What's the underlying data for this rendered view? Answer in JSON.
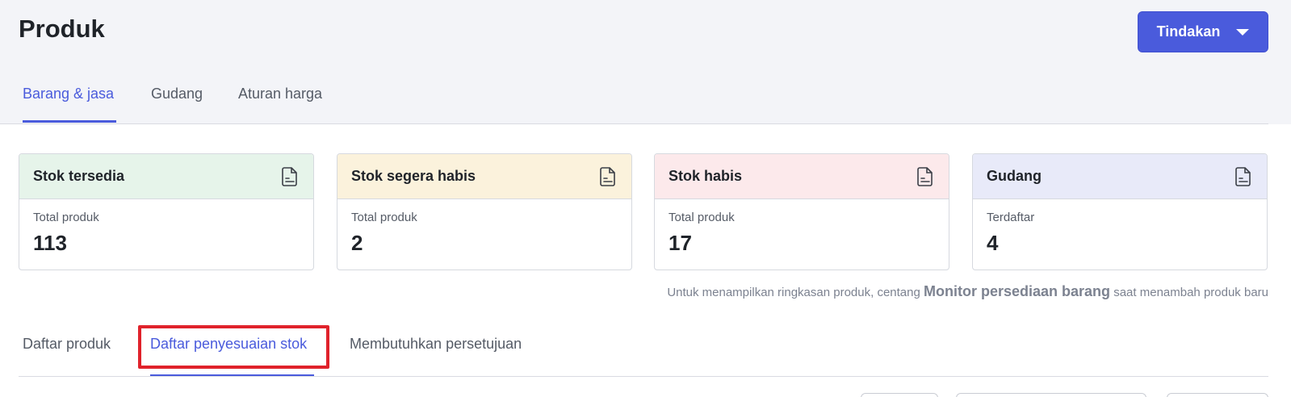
{
  "header": {
    "title": "Produk",
    "action_label": "Tindakan"
  },
  "main_tabs": [
    {
      "label": "Barang & jasa",
      "active": true
    },
    {
      "label": "Gudang",
      "active": false
    },
    {
      "label": "Aturan harga",
      "active": false
    }
  ],
  "cards": [
    {
      "title": "Stok tersedia",
      "label": "Total produk",
      "value": "113",
      "head_color": "#e6f4ea",
      "icon": "report-icon"
    },
    {
      "title": "Stok segera habis",
      "label": "Total produk",
      "value": "2",
      "head_color": "#fbf2dc",
      "icon": "report-icon"
    },
    {
      "title": "Stok habis",
      "label": "Total produk",
      "value": "17",
      "head_color": "#fce9eb",
      "icon": "report-icon"
    },
    {
      "title": "Gudang",
      "label": "Terdaftar",
      "value": "4",
      "head_color": "#e8eaf9",
      "icon": "report-icon"
    }
  ],
  "hint": {
    "before": "Untuk menampilkan ringkasan produk, centang ",
    "strong": "Monitor persediaan barang",
    "after": " saat menambah produk baru"
  },
  "sub_tabs": [
    {
      "label": "Daftar produk",
      "active": false
    },
    {
      "label": "Daftar penyesuaian stok",
      "active": true
    },
    {
      "label": "Membutuhkan persetujuan",
      "active": false
    }
  ],
  "colors": {
    "accent": "#4a5bdc",
    "highlight": "#e0222b"
  }
}
